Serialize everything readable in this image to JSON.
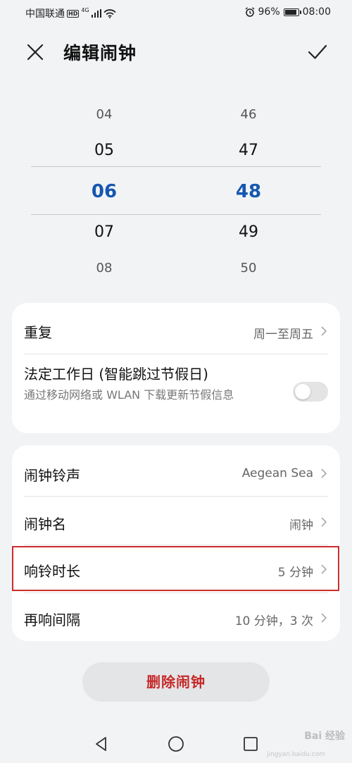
{
  "status_bar": {
    "carrier": "中国联通",
    "hd_badge": "HD",
    "network": "4G",
    "battery_percent": "96%",
    "battery_level": 0.96,
    "time": "08:00",
    "icons": [
      "signal-icon",
      "wifi-icon",
      "alarm-icon",
      "battery-icon"
    ]
  },
  "header": {
    "title": "编辑闹钟",
    "close_icon": "close-icon",
    "confirm_icon": "check-icon"
  },
  "picker": {
    "hours": [
      "04",
      "05",
      "06",
      "07",
      "08"
    ],
    "minutes": [
      "46",
      "47",
      "48",
      "49",
      "50"
    ],
    "selected_index": 2,
    "accent_color": "#1557b0"
  },
  "repeat_card": {
    "repeat_label": "重复",
    "repeat_value": "周一至周五",
    "workday_title": "法定工作日 (智能跳过节假日)",
    "workday_subtitle": "通过移动网络或 WLAN 下载更新节假信息",
    "workday_enabled": false
  },
  "settings_card": {
    "rows": [
      {
        "label": "闹钟铃声",
        "value": "Aegean Sea"
      },
      {
        "label": "闹钟名",
        "value": "闹钟"
      },
      {
        "label": "响铃时长",
        "value": "5 分钟"
      },
      {
        "label": "再响间隔",
        "value": "10 分钟，3 次"
      }
    ],
    "highlight_color": "#cc2b2b"
  },
  "actions": {
    "delete_label": "删除闹钟",
    "delete_color": "#c62828"
  },
  "nav_bar": {
    "icons": [
      "back-triangle-icon",
      "home-circle-icon",
      "recents-square-icon"
    ]
  },
  "watermark": {
    "brand": "Bai 经验",
    "url": "jingyan.baidu.com"
  }
}
